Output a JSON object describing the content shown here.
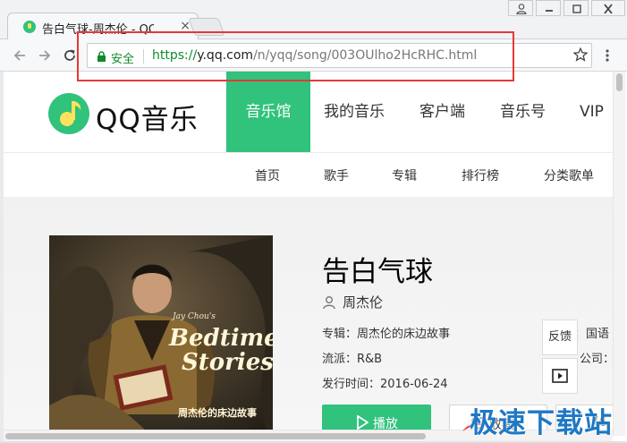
{
  "browser": {
    "tab_title": "告白气球-周杰伦 - QQ音",
    "tab_close": "×",
    "secure_label": "安全",
    "url": {
      "scheme": "https://",
      "host": "y.qq.com",
      "path": "/n/yqq/song/003OUlho2HcRHC.html"
    }
  },
  "site": {
    "logo_text": "QQ音乐",
    "nav": {
      "music_hall": "音乐馆",
      "my_music": "我的音乐",
      "client": "客户端",
      "musician": "音乐号",
      "vip": "VIP"
    },
    "subnav": {
      "home": "首页",
      "singer": "歌手",
      "album": "专辑",
      "rank": "排行榜",
      "playlist": "分类歌单"
    }
  },
  "song": {
    "title": "告白气球",
    "singer": "周杰伦",
    "album_line": "专辑：周杰伦的床边故事",
    "genre_line": "流派：R&B",
    "date_line": "发行时间：2016-06-24",
    "language_line": "：国语",
    "company_line": "公司：杰",
    "cover": {
      "caption": "Jay Chou's",
      "title_line1": "Bedtime",
      "title_line2": "Stories",
      "cn_text": "周杰伦的床边故事"
    }
  },
  "actions": {
    "play": "播放",
    "favorite": "收藏",
    "more": "(6"
  },
  "side": {
    "feedback": "反馈"
  },
  "watermark": "极速下载站",
  "colors": {
    "brand_green": "#31c27c",
    "secure_green": "#118a2b",
    "highlight_red": "#e53935",
    "watermark_blue": "#1f78c4"
  }
}
